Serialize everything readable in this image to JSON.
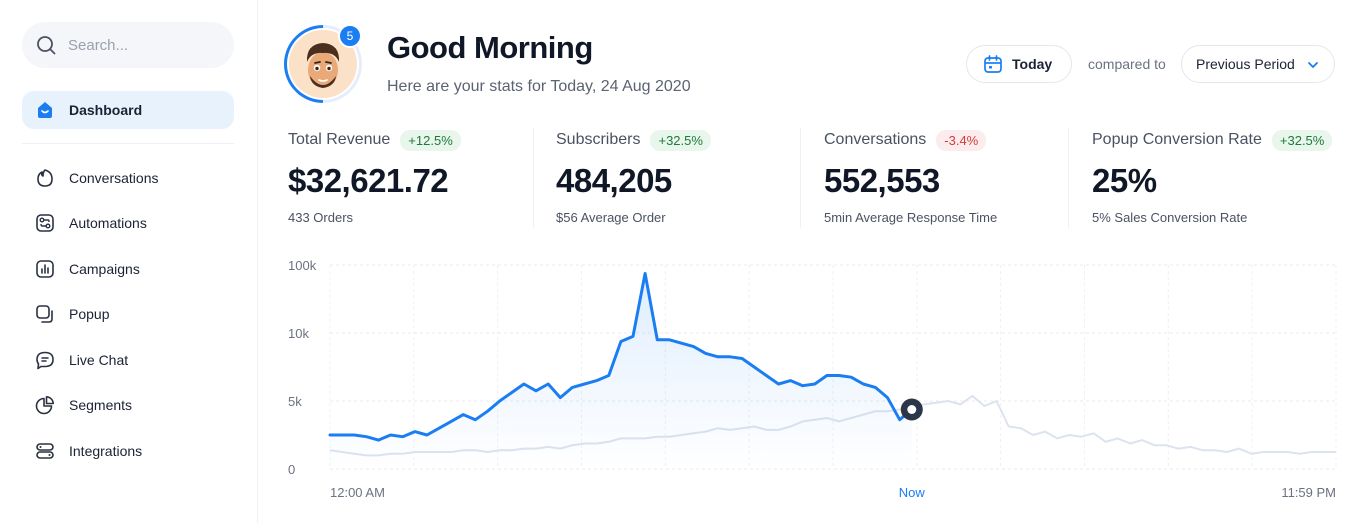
{
  "sidebar": {
    "search": {
      "placeholder": "Search...",
      "icon": "search-icon"
    },
    "active_item": {
      "label": "Dashboard",
      "icon": "dashboard-icon"
    },
    "items": [
      {
        "label": "Conversations",
        "icon": "conversations-icon"
      },
      {
        "label": "Automations",
        "icon": "automations-icon"
      },
      {
        "label": "Campaigns",
        "icon": "campaigns-icon"
      },
      {
        "label": "Popup",
        "icon": "popup-icon"
      },
      {
        "label": "Live Chat",
        "icon": "live-chat-icon"
      },
      {
        "label": "Segments",
        "icon": "segments-icon"
      },
      {
        "label": "Integrations",
        "icon": "integrations-icon"
      }
    ]
  },
  "header": {
    "notification_count": "5",
    "greeting": "Good Morning",
    "subtitle": "Here are your stats for Today, 24 Aug 2020",
    "today_label": "Today",
    "compared_to": "compared to",
    "period_label": "Previous Period"
  },
  "stats": [
    {
      "title": "Total Revenue",
      "change": "+12.5%",
      "trend": "up",
      "value": "$32,621.72",
      "sub": "433 Orders"
    },
    {
      "title": "Subscribers",
      "change": "+32.5%",
      "trend": "up",
      "value": "484,205",
      "sub": "$56 Average Order"
    },
    {
      "title": "Conversations",
      "change": "-3.4%",
      "trend": "down",
      "value": "552,553",
      "sub": "5min Average Response Time"
    },
    {
      "title": "Popup Conversion Rate",
      "change": "+32.5%",
      "trend": "up",
      "value": "25%",
      "sub": "5% Sales Conversion Rate"
    }
  ],
  "colors": {
    "accent": "#1a7ef2",
    "positive": "#1f7a3c",
    "negative": "#d43c3c",
    "previous_series": "#dde3ee"
  },
  "chart_data": {
    "type": "line",
    "y_ticks": [
      "100k",
      "10k",
      "5k",
      "0"
    ],
    "x_labels": [
      "12:00 AM",
      "Now",
      "11:59 PM"
    ],
    "marker_index": 48,
    "series": [
      {
        "role": "current",
        "values": [
          2.0,
          2.0,
          2.0,
          1.9,
          1.7,
          2.0,
          1.9,
          2.2,
          2.0,
          2.4,
          2.8,
          3.2,
          2.9,
          3.4,
          4.0,
          4.5,
          5.0,
          4.6,
          5.0,
          4.2,
          4.8,
          5.0,
          5.2,
          5.5,
          7.5,
          7.8,
          11.5,
          7.6,
          7.6,
          7.4,
          7.2,
          6.8,
          6.6,
          6.6,
          6.5,
          6.0,
          5.5,
          5.0,
          5.2,
          4.9,
          5.0,
          5.5,
          5.5,
          5.4,
          5.0,
          4.8,
          4.2,
          2.9,
          3.5
        ]
      },
      {
        "role": "previous",
        "values": [
          1.1,
          1.0,
          0.9,
          0.8,
          0.8,
          0.9,
          0.9,
          1.0,
          1.0,
          1.0,
          1.0,
          1.1,
          1.1,
          1.0,
          1.1,
          1.1,
          1.2,
          1.2,
          1.3,
          1.2,
          1.4,
          1.5,
          1.5,
          1.6,
          1.8,
          1.8,
          1.8,
          1.9,
          1.9,
          2.0,
          2.1,
          2.2,
          2.4,
          2.3,
          2.4,
          2.5,
          2.3,
          2.3,
          2.5,
          2.8,
          2.9,
          3.0,
          2.8,
          3.0,
          3.2,
          3.4,
          3.4,
          3.5,
          3.6,
          3.8,
          3.9,
          4.0,
          3.8,
          4.3,
          3.7,
          4.0,
          2.5,
          2.4,
          2.0,
          2.2,
          1.8,
          2.0,
          1.9,
          2.1,
          1.6,
          1.8,
          1.5,
          1.7,
          1.4,
          1.4,
          1.2,
          1.3,
          1.1,
          1.1,
          1.0,
          1.2,
          0.9,
          1.0,
          1.0,
          1.0,
          0.9,
          1.0,
          1.0,
          1.0
        ]
      }
    ]
  }
}
